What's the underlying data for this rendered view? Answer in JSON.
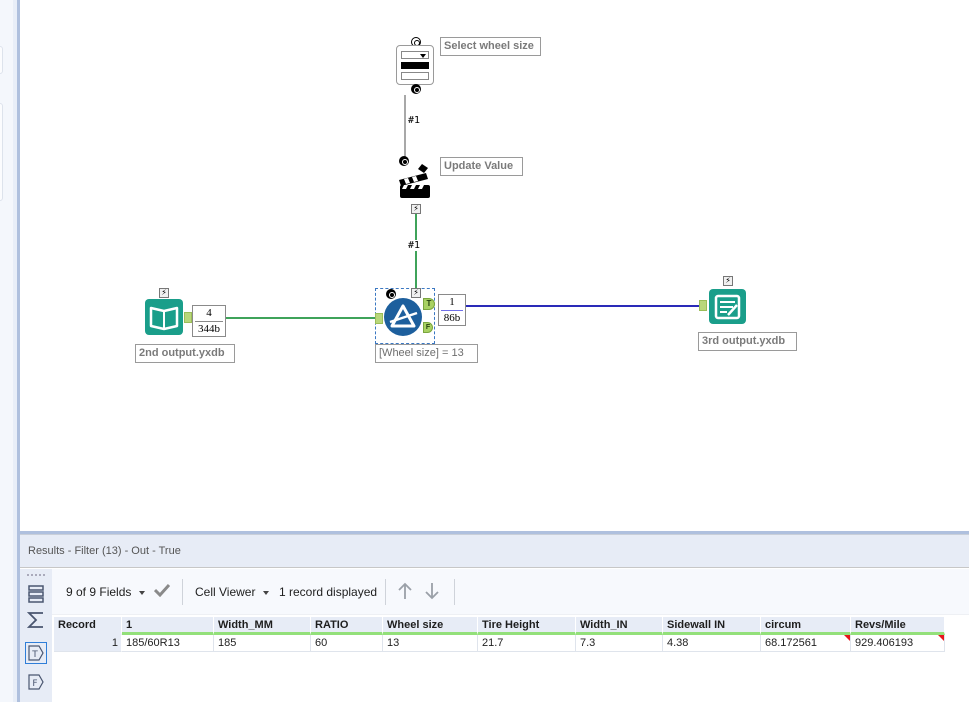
{
  "canvas": {
    "tools": {
      "dropdown": {
        "annotation": "Select wheel size",
        "icon": "dropdown-interface-icon"
      },
      "update_value": {
        "annotation": "Update Value",
        "icon": "clapperboard-icon"
      },
      "input": {
        "annotation": "2nd output.yxdb",
        "icon": "book-input-icon",
        "count_records": "4",
        "count_size": "344b"
      },
      "filter": {
        "annotation": "[Wheel size] = 13",
        "icon": "filter-prism-icon",
        "true_label": "T",
        "false_label": "F",
        "count_records": "1",
        "count_size": "86b"
      },
      "output": {
        "annotation": "3rd output.yxdb",
        "icon": "output-document-icon"
      }
    },
    "wire_labels": {
      "dropdown_to_update": "#1",
      "update_to_filter": "#1"
    },
    "bolt_glyph": "⚡",
    "colors": {
      "data_wire": "#3fa35a",
      "true_wire": "#2a2ab8",
      "teal": "#1a9e8a",
      "filter_blue": "#1d5f9d",
      "connector": "#a8d163"
    }
  },
  "results": {
    "title": "Results - Filter (13) - Out - True",
    "toolbar": {
      "fields_label": "9 of 9 Fields",
      "viewer_label": "Cell Viewer",
      "record_count": "1 record displayed"
    },
    "side_buttons": [
      "table-view",
      "summary",
      "true-anchor",
      "false-anchor"
    ],
    "side_labels": {
      "true": "T",
      "false": "F"
    },
    "columns": [
      "Record",
      "1",
      "Width_MM",
      "RATIO",
      "Wheel size",
      "Tire Height",
      "Width_IN",
      "Sidewall IN",
      "circum",
      "Revs/Mile"
    ],
    "rows": [
      [
        "1",
        "185/60R13",
        "185",
        "60",
        "13",
        "21.7",
        "7.3",
        "4.38",
        "68.172561",
        "929.406193"
      ]
    ]
  }
}
